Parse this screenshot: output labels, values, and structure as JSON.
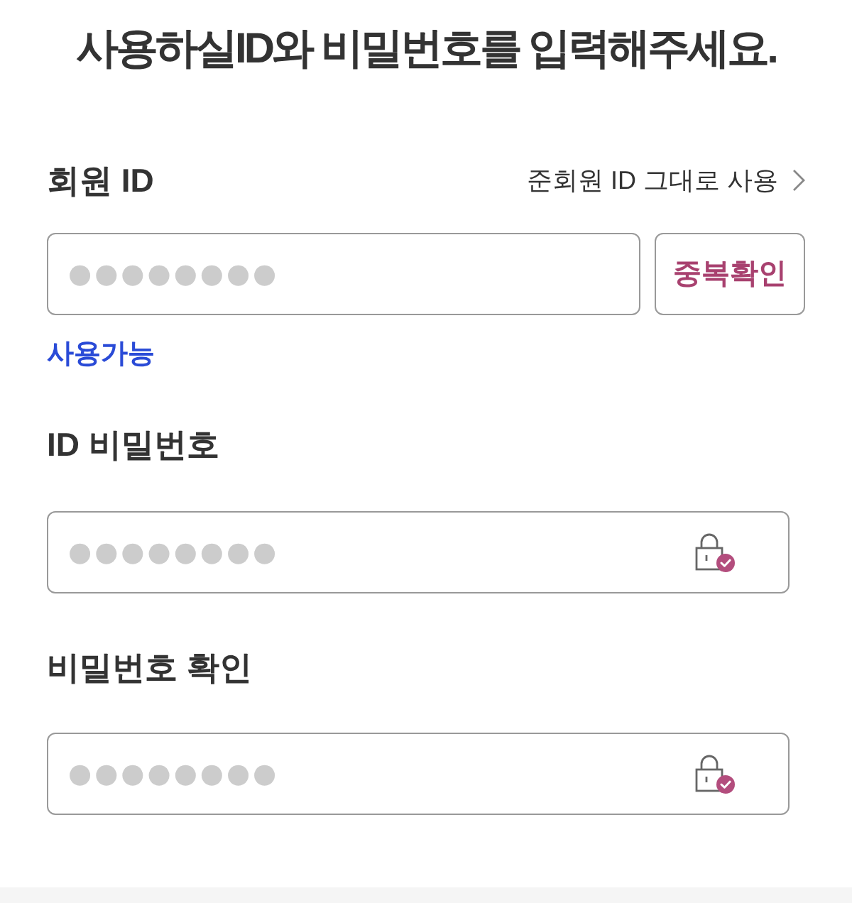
{
  "heading": "사용하실ID와 비밀번호를 입력해주세요.",
  "member_id": {
    "label": "회원 ID",
    "link": "준회원 ID 그대로 사용",
    "placeholder": "●●●●●●●●",
    "button": "중복확인",
    "message": "사용가능"
  },
  "password": {
    "label": "ID 비밀번호",
    "placeholder": "●●●●●●●●"
  },
  "password_confirm": {
    "label": "비밀번호 확인",
    "placeholder": "●●●●●●●●"
  }
}
